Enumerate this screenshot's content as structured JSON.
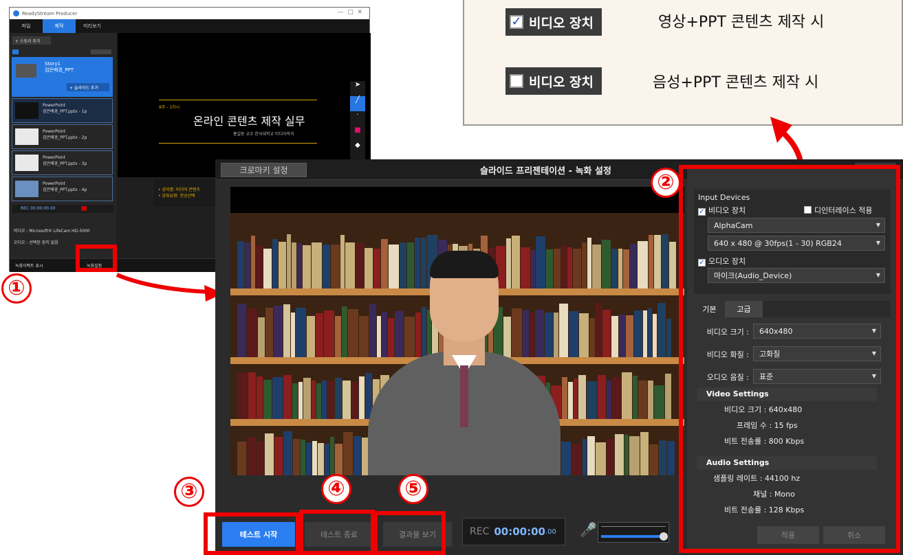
{
  "callout": {
    "row1": {
      "badge": "비디오 장치",
      "checked": true,
      "text": "영상+PPT 콘텐츠 제작 시"
    },
    "row2": {
      "badge": "비디오 장치",
      "checked": false,
      "text": "음성+PPT 콘텐츠 제작 시"
    }
  },
  "producer": {
    "title": "ReadyStream Producer",
    "menu": [
      "파일",
      "제작",
      "미리보기"
    ],
    "add_story": "+ 스토리 추가",
    "story": {
      "name": "Story1",
      "sub": "검은배경_PPT"
    },
    "add_slide": "+ 슬라이드 추가",
    "slides": [
      {
        "type": "PowerPoint",
        "name": "검은배경_PPT.pptx - 1p"
      },
      {
        "type": "PowerPoint",
        "name": "검은배경_PPT.pptx - 2p"
      },
      {
        "type": "PowerPoint",
        "name": "검은배경_PPT.pptx - 3p"
      },
      {
        "type": "PowerPoint",
        "name": "검은배경_PPT.pptx - 4p"
      }
    ],
    "rec_time": "REC 00:00:00.00",
    "slide_week": "8주 - 1차시",
    "slide_title": "온라인 콘텐츠 제작 실무",
    "slide_author": "홍길동 교수 한국대학교 미디어학과",
    "slide_bullets": [
      "• 강의명: 미디어 콘텐츠",
      "• 강좌유형: 전공선택"
    ],
    "video_device": "비디오 : Microsoft® LifeCam HD-5000",
    "audio_device": "오디오 : 선택된 장치 없음",
    "btn_chroma": "녹화이펙트 표시",
    "btn_rec_settings": "녹화설정"
  },
  "dialog": {
    "chroma_button": "크로마키 설정",
    "title": "슬라이드 프리젠테이션 - 녹화 설정",
    "input_devices_label": "Input Devices",
    "video_device_label": "비디오 장치",
    "video_device_checked": true,
    "deinterlace_label": "디인터레이스 적용",
    "video_device_select": "AlphaCam",
    "video_format_select": "640 x 480 @ 30fps(1 - 30) RGB24",
    "audio_device_label": "오디오 장치",
    "audio_device_checked": true,
    "audio_device_select": "마이크(Audio_Device)",
    "tabs": [
      "기본",
      "고급"
    ],
    "video_size_label": "비디오 크기 :",
    "video_size_value": "640x480",
    "video_quality_label": "비디오 화질 :",
    "video_quality_value": "고화질",
    "audio_quality_label": "오디오 음질 :",
    "audio_quality_value": "표준",
    "video_settings": {
      "header": "Video Settings",
      "size": "비디오 크기 : 640x480",
      "frames": "프레임 수 : 15 fps",
      "bitrate": "비트 전송률 : 800 Kbps"
    },
    "audio_settings": {
      "header": "Audio Settings",
      "sampling": "샘플링 레이트 : 44100 hz",
      "channel": "채널 : Mono",
      "bitrate": "비트 전송률 : 128 Kbps"
    },
    "apply_button": "적용",
    "cancel_button": "취소",
    "test_start": "테스트 시작",
    "test_end": "테스트 종료",
    "view_result": "결과물 보기",
    "rec_label": "REC",
    "rec_time": "00:00:00",
    "rec_ms": ".00",
    "mic_level": 0.95
  },
  "markers": [
    "①",
    "②",
    "③",
    "④",
    "⑤"
  ],
  "colors": {
    "accent": "#2678e0",
    "highlight": "#e00000"
  }
}
